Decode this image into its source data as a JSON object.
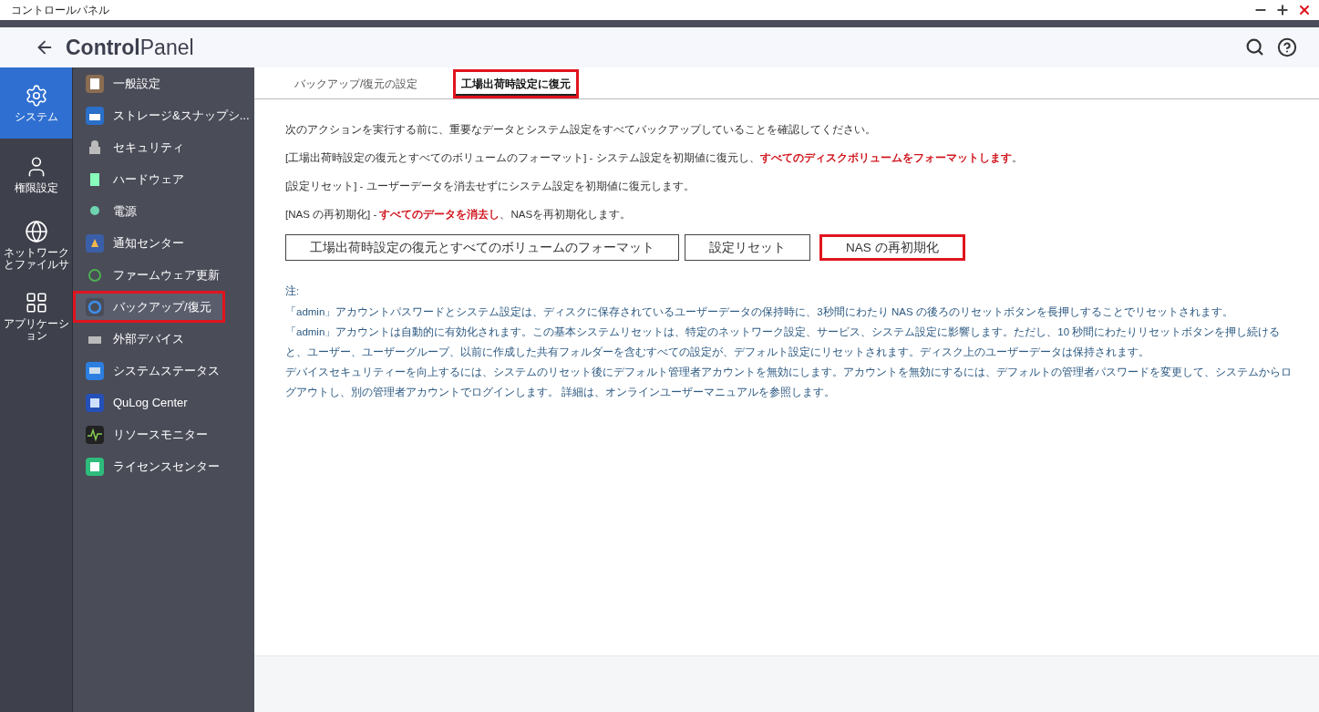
{
  "window": {
    "title": "コントロールパネル"
  },
  "header": {
    "title_bold": "Control",
    "title_rest": "Panel"
  },
  "rail": [
    {
      "label": "システム",
      "selected": true
    },
    {
      "label": "権限設定",
      "selected": false
    },
    {
      "label": "ネットワークとファイルサ",
      "selected": false
    },
    {
      "label": "アプリケーション",
      "selected": false
    }
  ],
  "sidebar": {
    "items": [
      {
        "label": "一般設定",
        "selected": false,
        "highlighted": false
      },
      {
        "label": "ストレージ&スナップシ...",
        "selected": false,
        "highlighted": false
      },
      {
        "label": "セキュリティ",
        "selected": false,
        "highlighted": false
      },
      {
        "label": "ハードウェア",
        "selected": false,
        "highlighted": false
      },
      {
        "label": "電源",
        "selected": false,
        "highlighted": false
      },
      {
        "label": "通知センター",
        "selected": false,
        "highlighted": false
      },
      {
        "label": "ファームウェア更新",
        "selected": false,
        "highlighted": false
      },
      {
        "label": "バックアップ/復元",
        "selected": true,
        "highlighted": true
      },
      {
        "label": "外部デバイス",
        "selected": false,
        "highlighted": false
      },
      {
        "label": "システムステータス",
        "selected": false,
        "highlighted": false
      },
      {
        "label": "QuLog Center",
        "selected": false,
        "highlighted": false
      },
      {
        "label": "リソースモニター",
        "selected": false,
        "highlighted": false
      },
      {
        "label": "ライセンスセンター",
        "selected": false,
        "highlighted": false
      }
    ]
  },
  "tabs": [
    {
      "label": "バックアップ/復元の設定",
      "selected": false,
      "highlighted": false
    },
    {
      "label": "工場出荷時設定に復元",
      "selected": true,
      "highlighted": true
    }
  ],
  "intro": [
    "次のアクションを実行する前に、重要なデータとシステム設定をすべてバックアップしていることを確認してください。",
    "[工場出荷時設定の復元とすべてのボリュームのフォーマット] - システム設定を初期値に復元し、**すべてのディスクボリュームをフォーマットします**。",
    "[設定リセット] - ユーザーデータを消去せずにシステム設定を初期値に復元します。",
    "[NAS の再初期化] - **すべてのデータを消去し**、NASを再初期化します。"
  ],
  "buttons": [
    {
      "label": "工場出荷時設定の復元とすべてのボリュームのフォーマット",
      "highlighted": false
    },
    {
      "label": "設定リセット",
      "highlighted": false
    },
    {
      "label": "NAS の再初期化",
      "highlighted": true
    }
  ],
  "note": {
    "heading": "注:",
    "paragraphs": [
      "「admin」アカウントパスワードとシステム設定は、ディスクに保存されているユーザーデータの保持時に、3秒間にわたり NAS の後ろのリセットボタンを長押しすることでリセットされます。",
      "「admin」アカウントは自動的に有効化されます。この基本システムリセットは、特定のネットワーク設定、サービス、システム設定に影響します。ただし、10 秒間にわたりリセットボタンを押し続けると、ユーザー、ユーザーグループ、以前に作成した共有フォルダーを含むすべての設定が、デフォルト設定にリセットされます。ディスク上のユーザーデータは保持されます。",
      "デバイスセキュリティーを向上するには、システムのリセット後にデフォルト管理者アカウントを無効にします。アカウントを無効にするには、デフォルトの管理者パスワードを変更して、システムからログアウトし、別の管理者アカウントでログインします。 詳細は、オンラインユーザーマニュアルを参照します。"
    ]
  }
}
